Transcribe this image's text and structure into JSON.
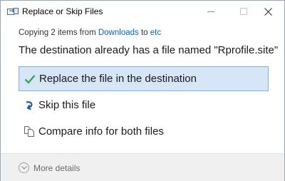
{
  "window": {
    "title": "Replace or Skip Files"
  },
  "dialog": {
    "copying_prefix": "Copying 2 items from",
    "source": "Downloads",
    "to_word": "to",
    "destination": "etc",
    "heading": "The destination already has a file named \"Rprofile.site\"",
    "options": [
      {
        "label": "Replace the file in the destination",
        "icon": "checkmark-icon",
        "selected": true
      },
      {
        "label": "Skip this file",
        "icon": "skip-arrow-icon",
        "selected": false
      },
      {
        "label": "Compare info for both files",
        "icon": "compare-files-icon",
        "selected": false
      }
    ]
  },
  "footer": {
    "more_details": "More details"
  },
  "colors": {
    "link": "#0066cc",
    "check": "#2ea04f",
    "skip": "#1f5fae",
    "selection_bg": "#d7e6f7",
    "selection_border": "#7fb1e3"
  }
}
